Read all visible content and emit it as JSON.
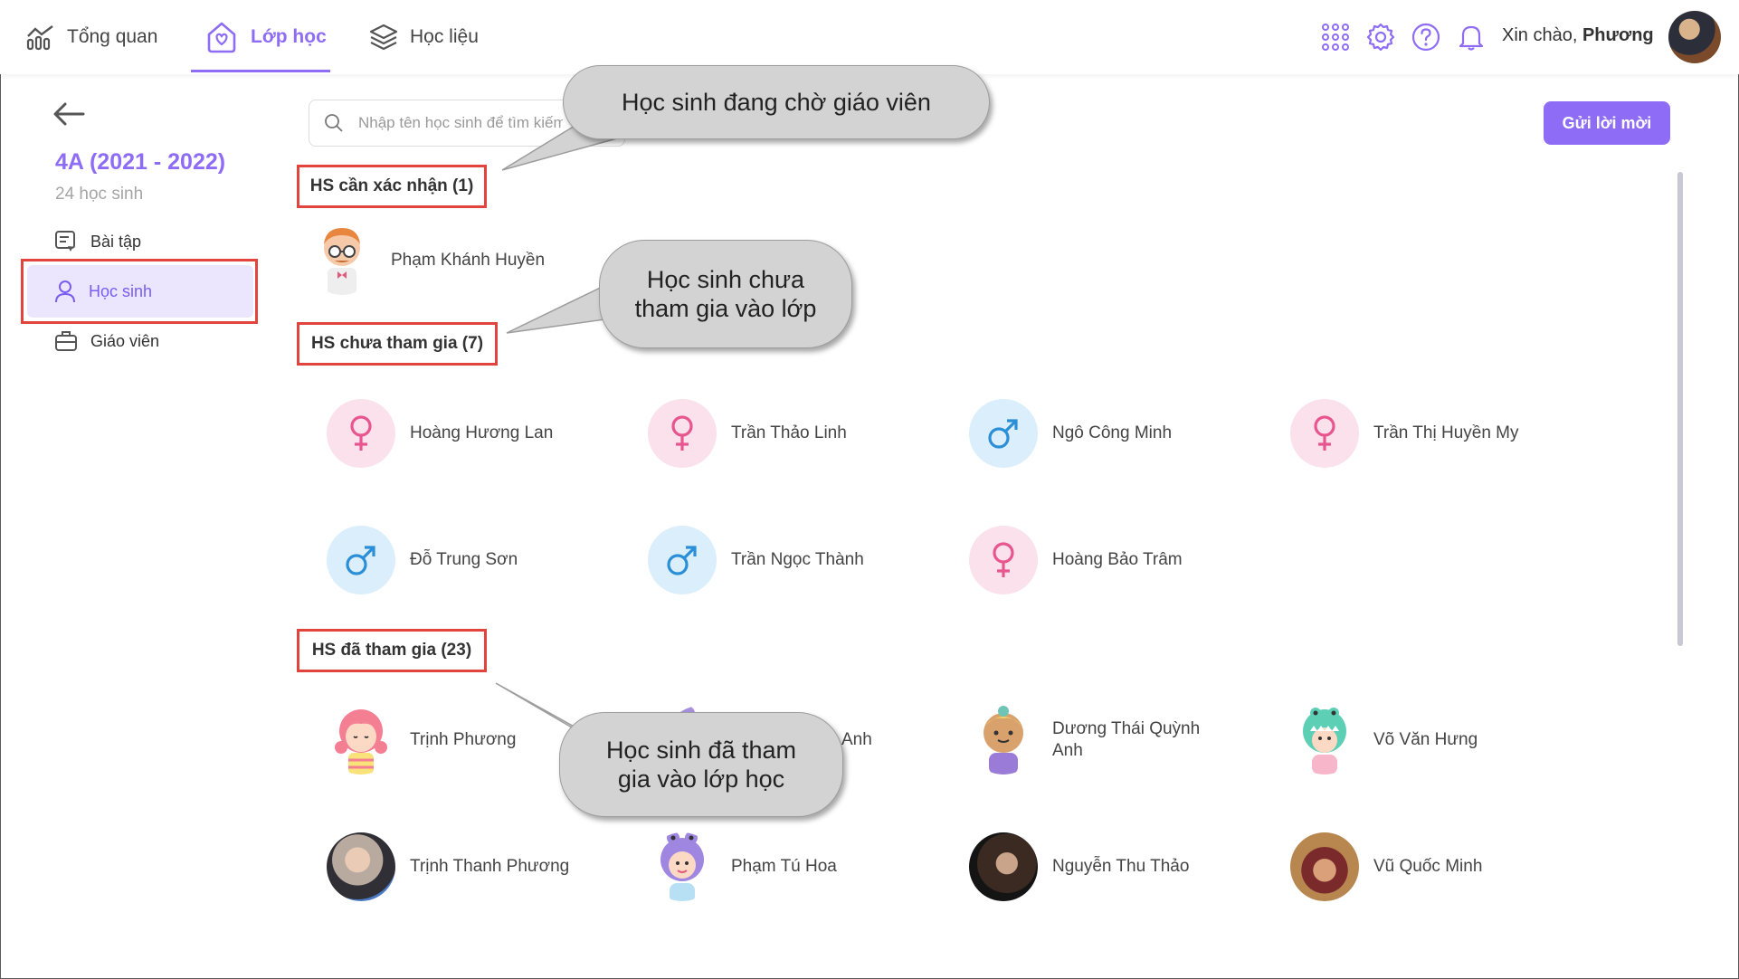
{
  "nav": {
    "overview": "Tổng quan",
    "classes": "Lớp học",
    "materials": "Học liệu",
    "greeting_prefix": "Xin chào, ",
    "greeting_name": "Phương"
  },
  "sidebar": {
    "class_title": "4A (2021 - 2022)",
    "student_count": "24 học sinh",
    "items": [
      {
        "label": "Bài tập"
      },
      {
        "label": "Học sinh"
      },
      {
        "label": "Giáo viên"
      }
    ]
  },
  "search": {
    "placeholder": "Nhập tên học sinh để tìm kiếm"
  },
  "invite_button": "Gửi lời mời",
  "sections": {
    "pending": {
      "label": "HS cần xác nhận (1)",
      "students": [
        {
          "name": "Phạm Khánh Huyền"
        }
      ]
    },
    "not_joined": {
      "label": "HS chưa tham gia (7)",
      "students": [
        {
          "name": "Hoàng Hương Lan",
          "gender": "female"
        },
        {
          "name": "Trần Thảo Linh",
          "gender": "female"
        },
        {
          "name": "Ngô Công Minh",
          "gender": "male"
        },
        {
          "name": "Trần Thị Huyền My",
          "gender": "female"
        },
        {
          "name": "Đỗ Trung Sơn",
          "gender": "male"
        },
        {
          "name": "Trần Ngọc Thành",
          "gender": "male"
        },
        {
          "name": "Hoàng Bảo Trâm",
          "gender": "female"
        }
      ]
    },
    "joined": {
      "label": "HS đã tham gia (23)",
      "students": [
        {
          "name": "Trịnh Phương"
        },
        {
          "name": "Anh"
        },
        {
          "name": "Dương Thái Quỳnh Anh"
        },
        {
          "name": "Võ Văn Hưng"
        },
        {
          "name": "Trịnh Thanh Phương"
        },
        {
          "name": "Phạm Tú Hoa"
        },
        {
          "name": "Nguyễn Thu Thảo"
        },
        {
          "name": "Vũ Quốc Minh"
        }
      ]
    }
  },
  "callouts": {
    "pending": "Học sinh đang chờ giáo viên",
    "not_joined_line1": "Học sinh chưa",
    "not_joined_line2": "tham gia vào lớp",
    "joined_line1": "Học sinh đã tham",
    "joined_line2": "gia vào lớp học"
  },
  "colors": {
    "accent": "#8e6cf5",
    "highlight_box": "#e0443c",
    "female": "#e8568f",
    "male": "#2b8fd8"
  }
}
